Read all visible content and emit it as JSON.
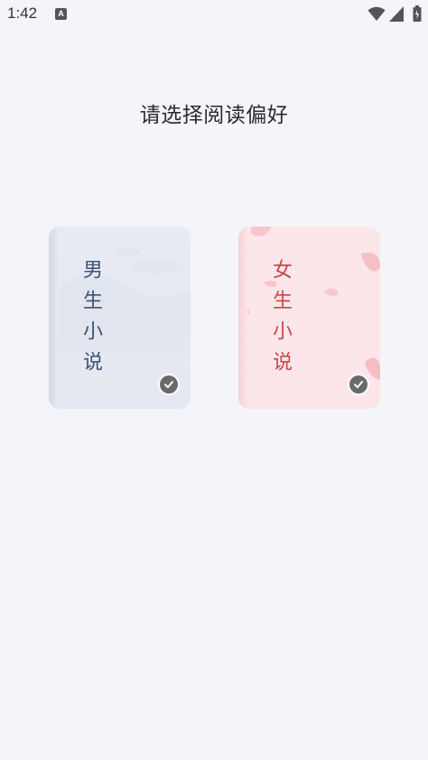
{
  "status_bar": {
    "time": "1:42",
    "app_icon_letter": "A",
    "icons": [
      "wifi-icon",
      "signal-icon",
      "battery-icon"
    ]
  },
  "page": {
    "title": "请选择阅读偏好"
  },
  "options": [
    {
      "label": "男生小说",
      "selected": true,
      "accent": "#3d5275",
      "background": "#e7eaf2"
    },
    {
      "label": "女生小说",
      "selected": true,
      "accent": "#c7484c",
      "background": "#fce6e9"
    }
  ],
  "colors": {
    "page_background": "#f4f5f9",
    "check_badge": "#6a6a6a"
  }
}
